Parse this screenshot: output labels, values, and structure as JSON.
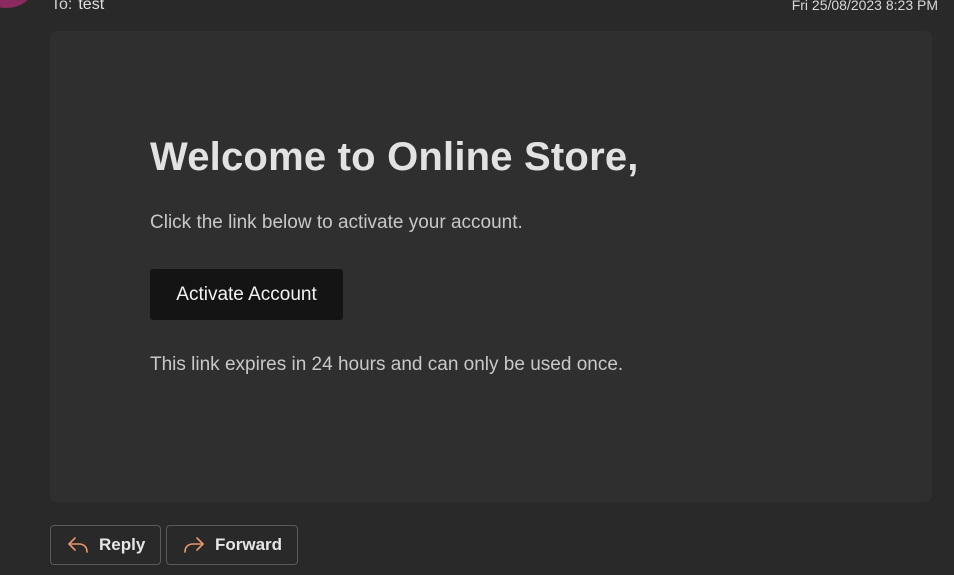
{
  "header": {
    "to_label": "To:",
    "to_value": "test",
    "date": "Fri 25/08/2023 8:23 PM"
  },
  "email": {
    "title": "Welcome to Online Store,",
    "intro": "Click the link below to activate your account.",
    "button_label": "Activate Account",
    "note": "This link expires in 24 hours and can only be used once."
  },
  "actions": {
    "reply_label": "Reply",
    "forward_label": "Forward",
    "reply_icon": "reply-arrow-icon",
    "forward_icon": "forward-arrow-icon"
  },
  "colors": {
    "background": "#292929",
    "card": "#2f2f2f",
    "button": "#141414",
    "icon_accent": "#e8976b",
    "avatar": "#8a2a5f"
  }
}
